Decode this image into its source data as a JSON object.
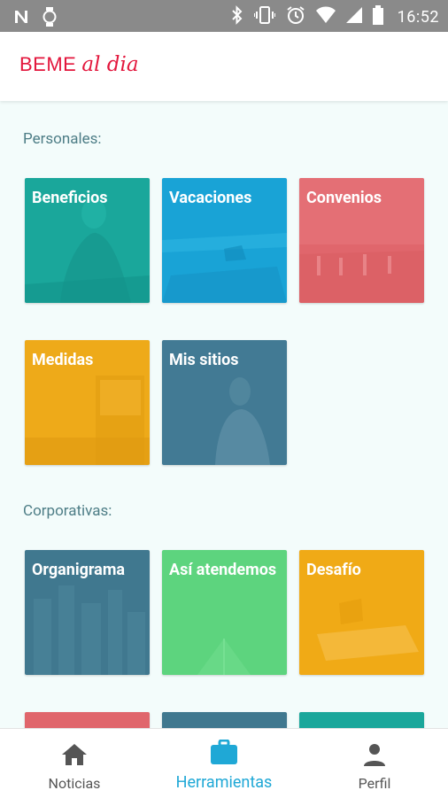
{
  "status_bar": {
    "time": "16:52"
  },
  "header": {
    "brand_main": "BEME",
    "brand_script": "al dia"
  },
  "sections": {
    "personales": {
      "title": "Personales:",
      "tiles": [
        {
          "label": "Beneficios",
          "color": "#1aa79b"
        },
        {
          "label": "Vacaciones",
          "color": "#19a3d6"
        },
        {
          "label": "Convenios",
          "color": "#e0666c"
        },
        {
          "label": "Medidas",
          "color": "#eeaa19"
        },
        {
          "label": "Mis sitios",
          "color": "#427a94"
        }
      ]
    },
    "corporativas": {
      "title": "Corporativas:",
      "tiles": [
        {
          "label": "Organigrama",
          "color": "#40788f"
        },
        {
          "label": "Así atendemos",
          "color": "#5dd47e"
        },
        {
          "label": "Desafío",
          "color": "#f0aa16"
        }
      ]
    }
  },
  "bottom_nav": {
    "items": [
      {
        "label": "Noticias",
        "icon": "home-icon"
      },
      {
        "label": "Herramientas",
        "icon": "briefcase-icon",
        "active": true
      },
      {
        "label": "Perfil",
        "icon": "person-icon"
      }
    ]
  },
  "colors": {
    "brand": "#e3163c",
    "accent": "#1fa8d6",
    "section_title": "#4d7d86"
  }
}
